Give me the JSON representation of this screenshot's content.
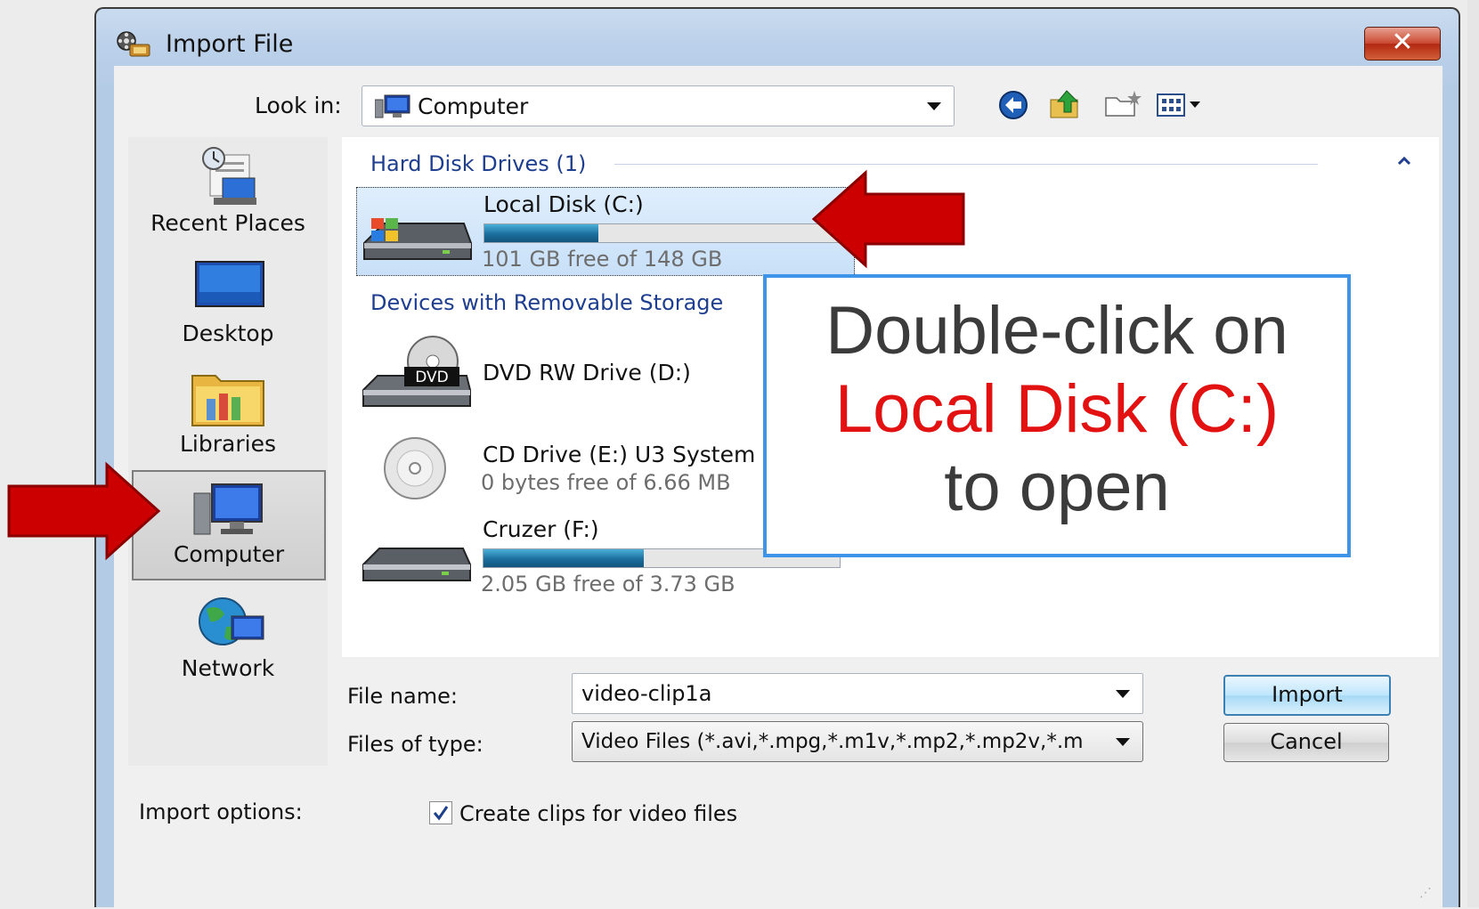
{
  "window": {
    "title": "Import File",
    "close_label": "✕"
  },
  "lookin": {
    "label": "Look in:",
    "value": "Computer"
  },
  "places": [
    {
      "label": "Recent Places",
      "icon": "recent-places-icon"
    },
    {
      "label": "Desktop",
      "icon": "desktop-icon"
    },
    {
      "label": "Libraries",
      "icon": "libraries-icon"
    },
    {
      "label": "Computer",
      "icon": "computer-icon",
      "selected": true
    },
    {
      "label": "Network",
      "icon": "network-icon"
    }
  ],
  "groups": {
    "hard_disk": "Hard Disk Drives (1)",
    "removable": "Devices with Removable Storage"
  },
  "drives": [
    {
      "name": "Local Disk (C:)",
      "free": "101 GB free of 148 GB",
      "used_fraction": 0.32
    },
    {
      "name": "DVD RW Drive (D:)"
    },
    {
      "name": "CD Drive (E:) U3 System",
      "free": "0 bytes free of 6.66 MB"
    },
    {
      "name": "Cruzer (F:)",
      "free": "2.05 GB free of 3.73 GB",
      "used_fraction": 0.45
    }
  ],
  "form": {
    "file_name_label": "File name:",
    "file_name_value": "video-clip1a",
    "file_type_label": "Files of type:",
    "file_type_value": "Video Files (*.avi,*.mpg,*.m1v,*.mp2,*.mp2v,*.m",
    "import_button": "Import",
    "cancel_button": "Cancel",
    "import_options_label": "Import options:",
    "create_clips_label": "Create clips for video files",
    "create_clips_checked": true
  },
  "callout": {
    "line1": "Double-click on",
    "line2": "Local Disk (C:)",
    "line3": "to open"
  },
  "colors": {
    "arrow": "#cc0000",
    "callout_border": "#3e94e8",
    "callout_highlight": "#e31212",
    "group_heading": "#1e3e8f"
  }
}
